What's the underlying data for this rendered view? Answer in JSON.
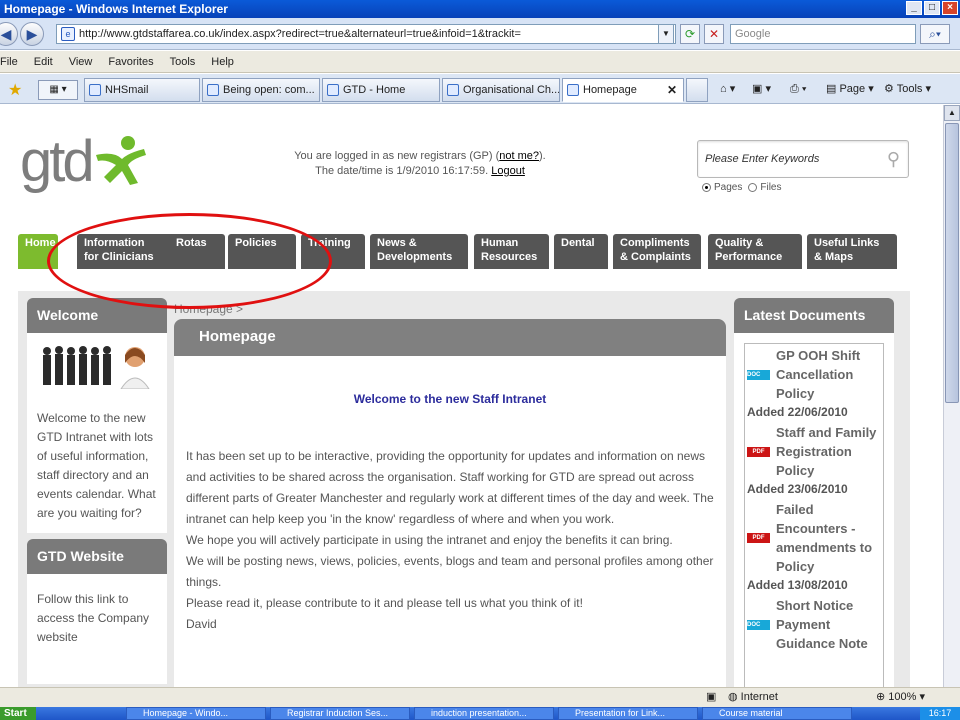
{
  "window": {
    "title": "Homepage - Windows Internet Explorer"
  },
  "address": {
    "url": "http://www.gtdstaffarea.co.uk/index.aspx?redirect=true&alternateurl=true&infoid=1&trackit=",
    "search_placeholder": "Google"
  },
  "menu": [
    "File",
    "Edit",
    "View",
    "Favorites",
    "Tools",
    "Help"
  ],
  "browser_tabs": [
    {
      "label": "NHSmail",
      "active": false
    },
    {
      "label": "Being open: com...",
      "active": false
    },
    {
      "label": "GTD - Home",
      "active": false
    },
    {
      "label": "Organisational Ch...",
      "active": false
    },
    {
      "label": "Homepage",
      "active": true
    }
  ],
  "iebar": {
    "page": "Page",
    "tools": "Tools"
  },
  "header": {
    "logo_text": "gtd",
    "login_prefix": "You are logged in as new registrars (GP) (",
    "login_link": "not me?",
    "login_suffix": ").",
    "datetime_prefix": "The date/time is 1/9/2010 16:17:59.",
    "logout": "Logout",
    "search_placeholder": "Please Enter Keywords",
    "radio_pages": "Pages",
    "radio_files": "Files"
  },
  "site_nav": [
    {
      "line1": "Home",
      "line2": ""
    },
    {
      "line1": "Information",
      "line2": "for Clinicians"
    },
    {
      "line1": "Rotas",
      "line2": ""
    },
    {
      "line1": "Policies",
      "line2": ""
    },
    {
      "line1": "Training",
      "line2": ""
    },
    {
      "line1": "News &",
      "line2": "Developments"
    },
    {
      "line1": "Human",
      "line2": "Resources"
    },
    {
      "line1": "Dental",
      "line2": ""
    },
    {
      "line1": "Compliments",
      "line2": "& Complaints"
    },
    {
      "line1": "Quality &",
      "line2": "Performance"
    },
    {
      "line1": "Useful Links",
      "line2": "& Maps"
    }
  ],
  "left": {
    "welcome_title": "Welcome",
    "welcome_text": "Welcome to the new GTD Intranet with lots of useful information, staff directory and an events calendar. What are you waiting for?",
    "website_title": "GTD Website",
    "website_text": "Follow this link to access the Company website"
  },
  "main": {
    "breadcrumb": "Homepage >",
    "title": "Homepage",
    "welcome": "Welcome to the new Staff Intranet",
    "paragraph": "It has been set up to be interactive, providing the opportunity for updates and information on news and activities to be shared across the organisation.  Staff working for GTD are spread out across different parts of Greater Manchester and regularly work at different times of the day and week.  The intranet can help keep you 'in the know' regardless of where and when you work.",
    "lines": [
      "We hope you will actively participate in using the intranet and enjoy the benefits it can bring.",
      "We will be posting news, views, policies, events, blogs and team and personal profiles among other things.",
      "Please read it, please contribute to it and please tell us what you think of it!",
      "David"
    ]
  },
  "latest": {
    "title": "Latest Documents",
    "docs": [
      {
        "type": "DOC",
        "title": "GP OOH Shift Cancellation Policy",
        "added": "Added 22/06/2010"
      },
      {
        "type": "PDF",
        "title": "Staff and Family Registration Policy",
        "added": "Added 23/06/2010"
      },
      {
        "type": "PDF",
        "title": "Failed Encounters - amendments to Policy",
        "added": "Added 13/08/2010"
      },
      {
        "type": "DOC",
        "title": "Short Notice Payment Guidance Note",
        "added": ""
      }
    ]
  },
  "status": {
    "zone": "Internet",
    "zoom": "100%"
  },
  "taskbar": {
    "start": "Start",
    "tasks": [
      "Homepage - Windo...",
      "Registrar Induction Ses...",
      "induction presentation...",
      "Presentation for Link...",
      "Course material"
    ],
    "clock": "16:17"
  },
  "colors": {
    "nav_home": "#7dbb2e",
    "nav_tab": "#555555",
    "welcome_text": "#2c2c9c",
    "annotation": "#e01010"
  }
}
